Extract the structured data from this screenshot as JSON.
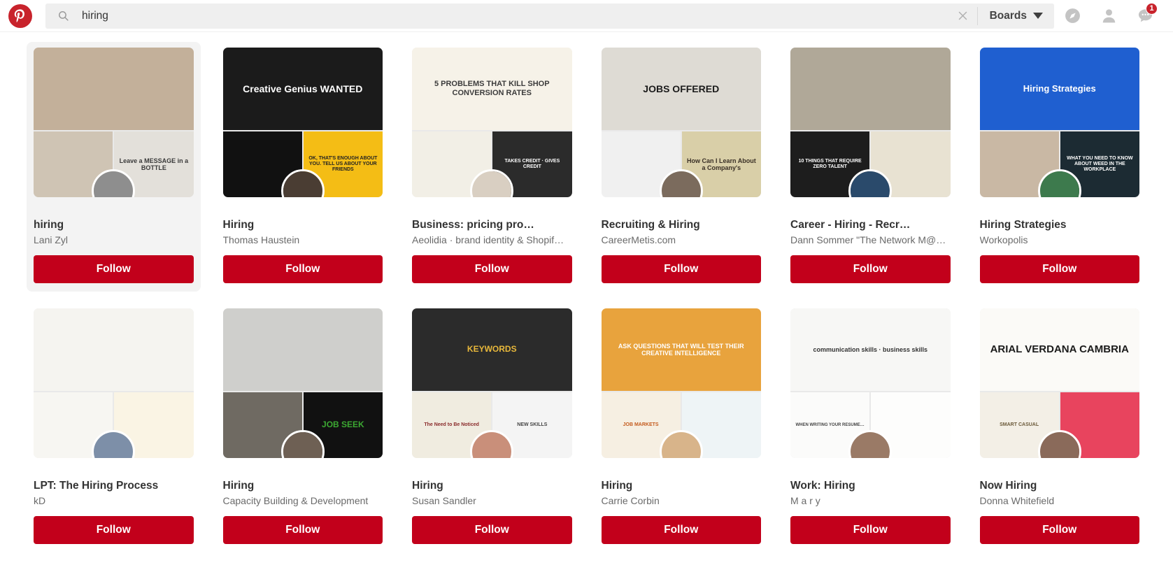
{
  "header": {
    "logo_icon": "pinterest-logo-icon",
    "search": {
      "icon": "search-icon",
      "value": "hiring",
      "placeholder": "Search"
    },
    "clear_icon": "close-icon",
    "boards_label": "Boards",
    "boards_caret_icon": "chevron-down-icon",
    "icons": [
      {
        "name": "compass-icon",
        "badge": null
      },
      {
        "name": "person-icon",
        "badge": null
      },
      {
        "name": "messages-icon",
        "badge": "1"
      }
    ],
    "accent_color": "#c2001b",
    "logo_color": "#c8232c",
    "searchbar_bg": "#efefef"
  },
  "results": {
    "follow_label": "Follow",
    "cards": [
      {
        "title": "hiring",
        "owner": "Lani Zyl",
        "hovered": true,
        "thumbs": {
          "big": {
            "bg": "#c3b09a",
            "text": "",
            "color": "#fff",
            "size": "10px"
          },
          "left": {
            "bg": "#cfc4b4",
            "text": "",
            "color": "#333",
            "size": "9px"
          },
          "right": {
            "bg": "#e3e0da",
            "text": "Leave a MESSAGE in a BOTTLE",
            "color": "#3a3a3a",
            "size": "9px"
          }
        },
        "avatar_bg": "#8e8e8e"
      },
      {
        "title": "Hiring",
        "owner": "Thomas Haustein",
        "hovered": false,
        "thumbs": {
          "big": {
            "bg": "#1b1b1b",
            "text": "Creative Genius WANTED",
            "color": "#ffffff",
            "size": "14px"
          },
          "left": {
            "bg": "#111111",
            "text": "",
            "color": "#fff",
            "size": "9px"
          },
          "right": {
            "bg": "#f4bd15",
            "text": "OK, THAT'S ENOUGH ABOUT YOU. TELL US ABOUT YOUR FRIENDS",
            "color": "#222",
            "size": "7px"
          }
        },
        "avatar_bg": "#4a3d33"
      },
      {
        "title": "Business: pricing pro…",
        "owner": "Aeolidia · brand identity & Shopif…",
        "hovered": false,
        "thumbs": {
          "big": {
            "bg": "#f6f2e8",
            "text": "5 PROBLEMS THAT KILL SHOP CONVERSION RATES",
            "color": "#3c3c3c",
            "size": "11px"
          },
          "left": {
            "bg": "#f2efe6",
            "text": "",
            "color": "#444",
            "size": "8px"
          },
          "right": {
            "bg": "#2b2b2b",
            "text": "TAKES CREDIT · GIVES CREDIT",
            "color": "#fff",
            "size": "7px"
          }
        },
        "avatar_bg": "#d9cfc2"
      },
      {
        "title": "Recruiting & Hiring",
        "owner": "CareerMetis.com",
        "hovered": false,
        "thumbs": {
          "big": {
            "bg": "#dedbd4",
            "text": "JOBS OFFERED",
            "color": "#1b1b1b",
            "size": "14px"
          },
          "left": {
            "bg": "#f0f0f0",
            "text": "",
            "color": "#333",
            "size": "8px"
          },
          "right": {
            "bg": "#d9cfa8",
            "text": "How Can I Learn About a Company's",
            "color": "#3a3026",
            "size": "9px"
          }
        },
        "avatar_bg": "#7b6b5d"
      },
      {
        "title": "Career - Hiring - Recr…",
        "owner": "Dann Sommer \"The Network M@…",
        "hovered": false,
        "thumbs": {
          "big": {
            "bg": "#b0a898",
            "text": "",
            "color": "#fff",
            "size": "10px"
          },
          "left": {
            "bg": "#1d1d1d",
            "text": "10 THINGS THAT REQUIRE ZERO TALENT",
            "color": "#fff",
            "size": "7px"
          },
          "right": {
            "bg": "#e8e2d2",
            "text": "",
            "color": "#333",
            "size": "8px"
          }
        },
        "avatar_bg": "#2a4a6b"
      },
      {
        "title": "Hiring Strategies",
        "owner": "Workopolis",
        "hovered": false,
        "thumbs": {
          "big": {
            "bg": "#1f5fd0",
            "text": "Hiring Strategies",
            "color": "#ffffff",
            "size": "13px"
          },
          "left": {
            "bg": "#c9b8a4",
            "text": "",
            "color": "#333",
            "size": "8px"
          },
          "right": {
            "bg": "#1c2b33",
            "text": "WHAT YOU NEED TO KNOW ABOUT WEED IN THE WORKPLACE",
            "color": "#fff",
            "size": "7px"
          }
        },
        "avatar_bg": "#3d7a4d"
      },
      {
        "title": "LPT: The Hiring Process",
        "owner": "kD",
        "hovered": false,
        "thumbs": {
          "big": {
            "bg": "#f5f4f0",
            "text": "",
            "color": "#555",
            "size": "6px"
          },
          "left": {
            "bg": "#f7f6f2",
            "text": "",
            "color": "#555",
            "size": "7px"
          },
          "right": {
            "bg": "#faf4e4",
            "text": "",
            "color": "#6b5a3a",
            "size": "7px"
          }
        },
        "avatar_bg": "#7d8fa8"
      },
      {
        "title": "Hiring",
        "owner": "Capacity Building & Development",
        "hovered": false,
        "thumbs": {
          "big": {
            "bg": "#cfcfcc",
            "text": "",
            "color": "#333",
            "size": "8px"
          },
          "left": {
            "bg": "#6f6a62",
            "text": "",
            "color": "#fff",
            "size": "8px"
          },
          "right": {
            "bg": "#111111",
            "text": "JOB SEEK",
            "color": "#3ca832",
            "size": "12px"
          }
        },
        "avatar_bg": "#6e6054"
      },
      {
        "title": "Hiring",
        "owner": "Susan Sandler",
        "hovered": false,
        "thumbs": {
          "big": {
            "bg": "#2b2b2b",
            "text": "KEYWORDS",
            "color": "#e8b83b",
            "size": "12px"
          },
          "left": {
            "bg": "#f0ece0",
            "text": "The Need to Be Noticed",
            "color": "#8a2b2b",
            "size": "7px"
          },
          "right": {
            "bg": "#f4f4f4",
            "text": "NEW SKILLS",
            "color": "#444",
            "size": "7px"
          }
        },
        "avatar_bg": "#c98f7a"
      },
      {
        "title": "Hiring",
        "owner": "Carrie Corbin",
        "hovered": false,
        "thumbs": {
          "big": {
            "bg": "#e8a33d",
            "text": "ASK QUESTIONS THAT WILL TEST THEIR CREATIVE INTELLIGENCE",
            "color": "#ffffff",
            "size": "9px"
          },
          "left": {
            "bg": "#f6efe2",
            "text": "JOB MARKETS",
            "color": "#c45b1e",
            "size": "7px"
          },
          "right": {
            "bg": "#eef4f6",
            "text": "",
            "color": "#2b6a8a",
            "size": "7px"
          }
        },
        "avatar_bg": "#d8b48a"
      },
      {
        "title": "Work: Hiring",
        "owner": "M a r y",
        "hovered": false,
        "thumbs": {
          "big": {
            "bg": "#f7f7f5",
            "text": "communication skills · business skills",
            "color": "#333",
            "size": "9px"
          },
          "left": {
            "bg": "#fbfbfa",
            "text": "WHEN WRITING YOUR RESUME…",
            "color": "#444",
            "size": "6px"
          },
          "right": {
            "bg": "#fdfdfc",
            "text": "",
            "color": "#444",
            "size": "6px"
          }
        },
        "avatar_bg": "#9a7a66"
      },
      {
        "title": "Now Hiring",
        "owner": "Donna Whitefield",
        "hovered": false,
        "thumbs": {
          "big": {
            "bg": "#fbfaf7",
            "text": "ARIAL VERDANA CAMBRIA",
            "color": "#1b1b1b",
            "size": "15px"
          },
          "left": {
            "bg": "#f3efe6",
            "text": "SMART CASUAL",
            "color": "#6b5a3a",
            "size": "7px"
          },
          "right": {
            "bg": "#e8445e",
            "text": "",
            "color": "#fff",
            "size": "7px"
          }
        },
        "avatar_bg": "#8a6a5a"
      }
    ]
  }
}
